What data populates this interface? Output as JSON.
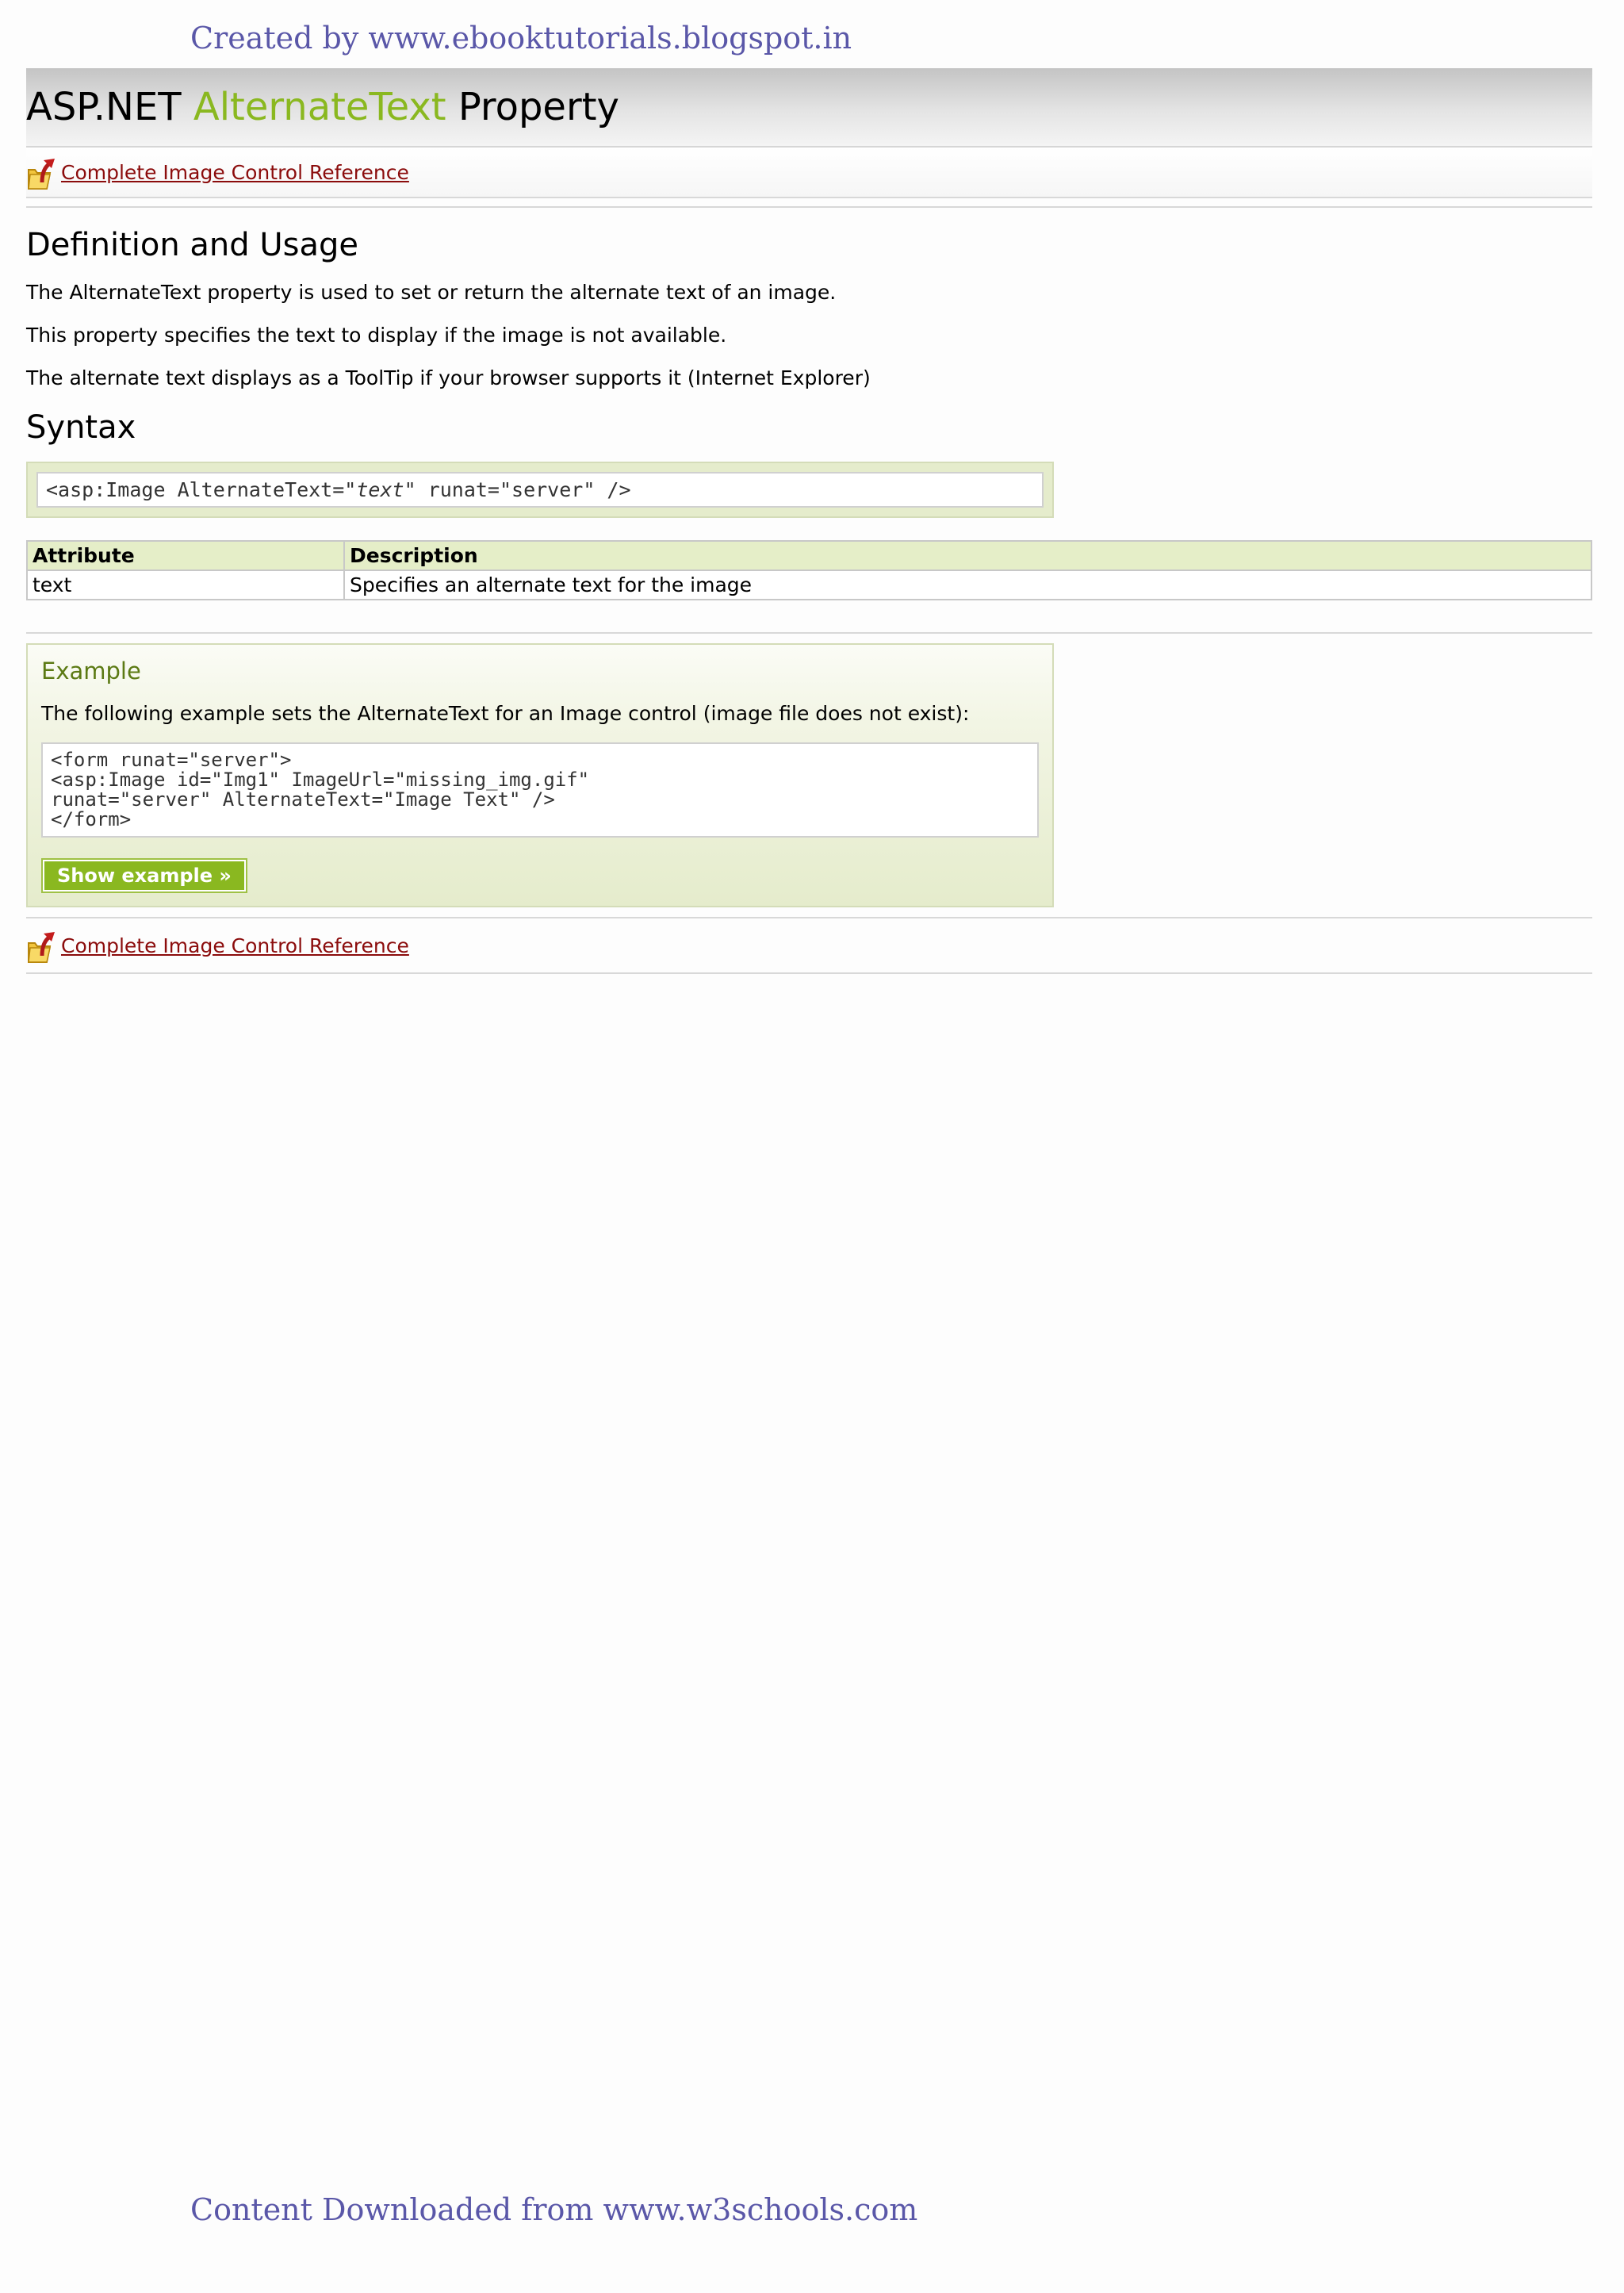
{
  "watermark": {
    "top": "Created by www.ebooktutorials.blogspot.in",
    "bottom": "Content Downloaded from www.w3schools.com"
  },
  "title": {
    "prefix": "ASP.NET",
    "accent": "AlternateText",
    "suffix": "Property"
  },
  "nav": {
    "reference_link": " Complete Image Control Reference",
    "icon": "folder-up-icon"
  },
  "definition": {
    "heading": "Definition and Usage",
    "paragraphs": [
      "The AlternateText property is used to set or return the alternate text of an image.",
      "This property specifies the text to display if the image is not available.",
      "The alternate text displays as a ToolTip if your browser supports it (Internet Explorer)"
    ]
  },
  "syntax": {
    "heading": "Syntax",
    "code_before": "<asp:Image AlternateText=\"",
    "code_italic": "text",
    "code_after": "\" runat=\"server\" />"
  },
  "attr_table": {
    "headers": [
      "Attribute",
      "Description"
    ],
    "rows": [
      [
        "text",
        "Specifies an alternate text for the image"
      ]
    ]
  },
  "example": {
    "title": "Example",
    "description": "The following example sets the AlternateText for an Image control (image file does not exist):",
    "code": "<form runat=\"server\">\n<asp:Image id=\"Img1\" ImageUrl=\"missing_img.gif\"\nrunat=\"server\" AlternateText=\"Image Text\" />\n</form>",
    "button_label": "Show example »"
  },
  "colors": {
    "accent_green": "#8ab820",
    "link_red": "#8b0c0c",
    "watermark_purple": "#5a57a8",
    "example_title_green": "#5c7a14",
    "panel_green": "#e5eccc"
  }
}
